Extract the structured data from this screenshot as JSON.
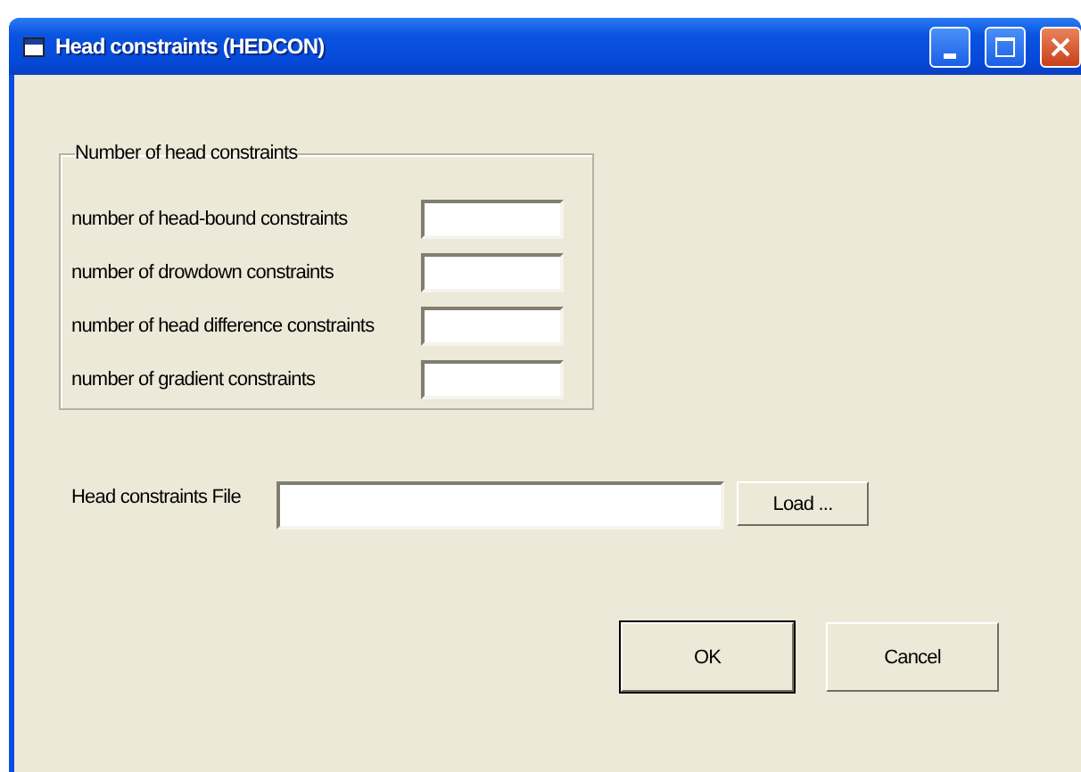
{
  "window": {
    "title": "Head constraints (HEDCON)"
  },
  "group": {
    "legend": "Number of head constraints",
    "fields": [
      {
        "label": "number of head-bound constraints"
      },
      {
        "label": "number of drowdown constraints"
      },
      {
        "label": "number of head difference constraints"
      },
      {
        "label": "number of gradient constraints"
      }
    ]
  },
  "file": {
    "label": "Head constraints File",
    "button": "Load ..."
  },
  "buttons": [
    {
      "label": "OK",
      "default": true
    },
    {
      "label": "Cancel",
      "default": false
    }
  ]
}
